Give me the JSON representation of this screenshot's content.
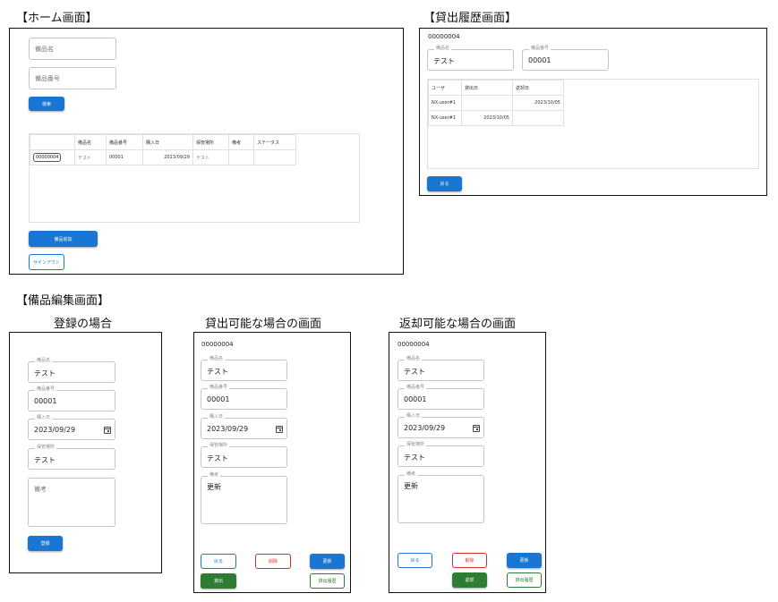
{
  "home": {
    "title": "【ホーム画面】",
    "name_placeholder": "備品名",
    "number_placeholder": "備品番号",
    "search_label": "検索",
    "table": {
      "headers": [
        "",
        "備品名",
        "備品番号",
        "購入日",
        "保管場所",
        "備考",
        "ステータス"
      ],
      "rows": [
        [
          "00000004",
          "テスト",
          "00001",
          "2023/09/29",
          "テスト",
          "",
          ""
        ]
      ]
    },
    "add_label": "備品追加",
    "signout_label": "サインアウト"
  },
  "history": {
    "title": "【貸出履歴画面】",
    "item_id": "00000004",
    "name_label": "備品名",
    "name_value": "テスト",
    "number_label": "備品番号",
    "number_value": "00001",
    "table": {
      "headers": [
        "ユーザ",
        "貸出日",
        "返却日"
      ],
      "rows": [
        [
          "NX-user#1",
          "",
          "2023/10/05"
        ],
        [
          "NX-user#1",
          "2023/10/05",
          ""
        ]
      ]
    },
    "back_label": "戻る"
  },
  "edit": {
    "title": "【備品編集画面】",
    "labels": {
      "name": "備品名",
      "number": "備品番号",
      "date": "購入日",
      "location": "保管場所",
      "note": "備考"
    },
    "register": {
      "caption": "登録の場合",
      "name": "テスト",
      "number": "00001",
      "date": "2023/09/29",
      "location": "テスト",
      "note_placeholder": "備考",
      "register_label": "登録"
    },
    "lendable": {
      "caption": "貸出可能な場合の画面",
      "item_id": "00000004",
      "name": "テスト",
      "number": "00001",
      "date": "2023/09/29",
      "location": "テスト",
      "note": "更新",
      "back_label": "戻る",
      "delete_label": "削除",
      "update_label": "更新",
      "lend_label": "貸出",
      "history_label": "貸出履歴"
    },
    "returnable": {
      "caption": "返却可能な場合の画面",
      "item_id": "00000004",
      "name": "テスト",
      "number": "00001",
      "date": "2023/09/29",
      "location": "テスト",
      "note": "更新",
      "back_label": "戻る",
      "delete_label": "削除",
      "update_label": "更新",
      "return_label": "返却",
      "history_label": "貸出履歴"
    }
  },
  "colors": {
    "primary": "#1976d2",
    "success": "#2e7d32",
    "error": "#d32f2f",
    "border": "#c4c4c4"
  }
}
